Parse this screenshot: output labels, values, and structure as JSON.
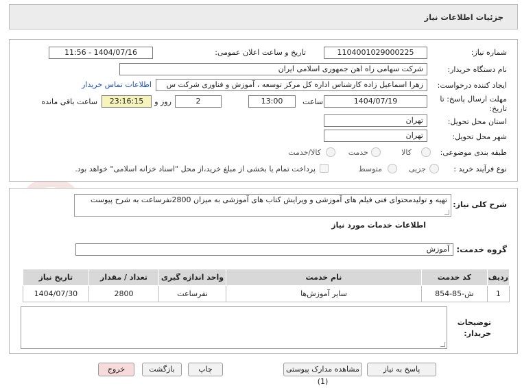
{
  "header": {
    "title": "جزئیات اطلاعات نیاز"
  },
  "fields": {
    "need_number_label": "شماره نیاز:",
    "need_number": "1104001029000225",
    "announce_label": "تاریخ و ساعت اعلان عمومی:",
    "announce_value": "1404/07/16 - 11:56",
    "buyer_org_label": "نام دستگاه خریدار:",
    "buyer_org": "شرکت سهامی راه اهن جمهوری اسلامی ایران",
    "requester_label": "ایجاد کننده درخواست:",
    "requester": "زهرا اسماعیل زاده کارشناس اداره کل مرکز توسعه ، آموزش و فناوری شرکت س",
    "contact_link": "اطلاعات تماس خریدار",
    "deadline_label_1": "مهلت ارسال پاسخ: تا",
    "deadline_label_2": "تاریخ:",
    "deadline_date": "1404/07/19",
    "time_label": "ساعت",
    "deadline_time": "13:00",
    "days_value": "2",
    "days_label": "روز و",
    "remaining_time": "23:16:15",
    "remaining_label": "ساعت باقی مانده",
    "province_label": "استان محل تحویل:",
    "province": "تهران",
    "city_label": "شهر محل تحویل:",
    "city": "تهران",
    "category_label": "طبقه بندی موضوعی:",
    "category_options": [
      "کالا",
      "خدمت",
      "کالا/خدمت"
    ],
    "process_label": "نوع فرآیند خرید :",
    "process_options": [
      "جزیی",
      "متوسط"
    ],
    "payment_note": "پرداخت تمام یا بخشی از مبلغ خرید،از محل \"اسناد خزانه اسلامی\" خواهد بود."
  },
  "description": {
    "label": "شرح کلی نیاز:",
    "text": "تهیه و تولیدمحتوای فنی فیلم های آموزشی و ویرایش کتاب های آموزشی به میزان 2800نفرساعت به شرح پیوست"
  },
  "services": {
    "section_title": "اطلاعات خدمات مورد نیاز",
    "group_label": "گروه خدمت:",
    "group_value": "آموزش",
    "table": {
      "headers": [
        "ردیف",
        "کد خدمت",
        "نام خدمت",
        "واحد اندازه گیری",
        "تعداد / مقدار",
        "تاریخ نیاز"
      ],
      "rows": [
        [
          "1",
          "ش-85-854",
          "سایر آموزش‌ها",
          "نفرساعت",
          "2800",
          "1404/07/30"
        ]
      ]
    }
  },
  "buyer_notes": {
    "label_1": "توضیحات",
    "label_2": "خریدار:"
  },
  "buttons": {
    "reply": "پاسخ به نیاز",
    "attachments": "مشاهده مدارک پیوستی (1)",
    "print": "چاپ",
    "back": "بازگشت",
    "exit": "خروج"
  },
  "watermark": "AriaTender.net"
}
